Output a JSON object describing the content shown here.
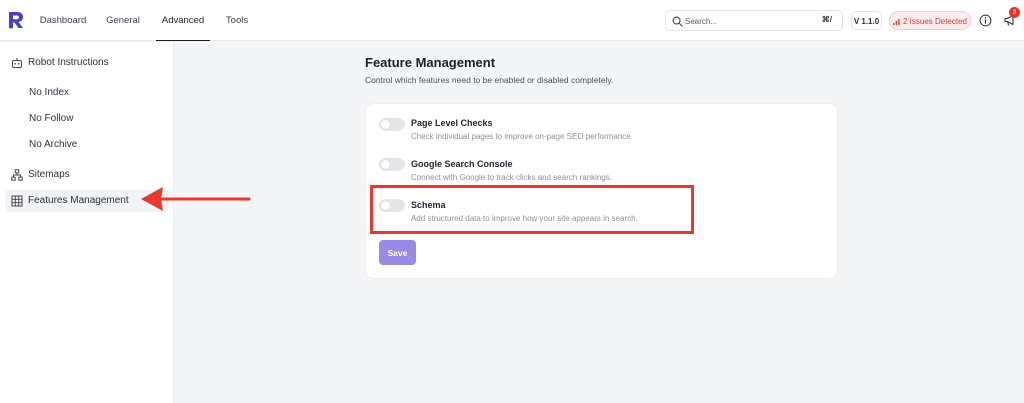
{
  "nav": {
    "tabs": [
      {
        "label": "Dashboard"
      },
      {
        "label": "General"
      },
      {
        "label": "Advanced"
      },
      {
        "label": "Tools"
      }
    ],
    "active_tab": "Advanced"
  },
  "header": {
    "search_placeholder": "Search...",
    "search_shortcut": "⌘/",
    "version": "V 1.1.0",
    "issues_label": "2 Issues Detected",
    "notification_count": "3"
  },
  "sidebar": {
    "items": [
      {
        "label": "Robot Instructions",
        "icon": "robot-icon"
      },
      {
        "label": "Sitemaps",
        "icon": "sitemap-icon"
      },
      {
        "label": "Features Management",
        "icon": "grid-icon"
      }
    ],
    "sub_items": [
      {
        "label": "No Index"
      },
      {
        "label": "No Follow"
      },
      {
        "label": "No Archive"
      }
    ]
  },
  "main": {
    "title": "Feature Management",
    "subtitle": "Control which features need to be enabled or disabled completely.",
    "features": [
      {
        "title": "Page Level Checks",
        "description": "Check individual pages to improve on-page SEO performance.",
        "enabled": false
      },
      {
        "title": "Google Search Console",
        "description": "Connect with Google to track clicks and search rankings.",
        "enabled": false
      },
      {
        "title": "Schema",
        "description": "Add structured data to improve how your site appears in search.",
        "enabled": false
      }
    ],
    "save_label": "Save"
  },
  "colors": {
    "accent": "#9a8ae6",
    "annotation": "#e8392c",
    "issues_text": "#d33b3b",
    "badge": "#e5332a",
    "logo": "#4a3fc6"
  }
}
